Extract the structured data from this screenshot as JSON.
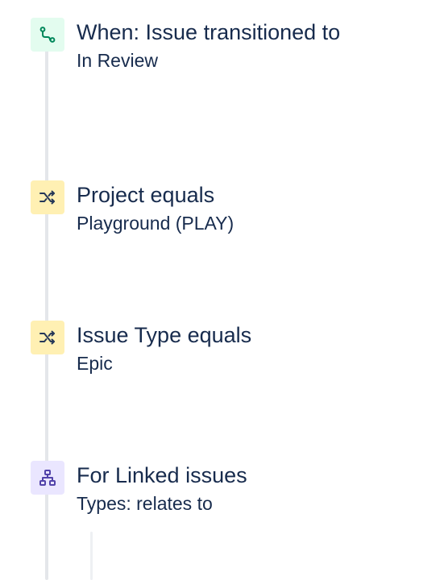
{
  "steps": [
    {
      "kind": "trigger",
      "icon": "trigger-path-icon",
      "title": "When: Issue transitioned to",
      "detail": "In Review"
    },
    {
      "kind": "condition",
      "icon": "shuffle-icon",
      "title": "Project equals",
      "detail": "Playground (PLAY)"
    },
    {
      "kind": "condition",
      "icon": "shuffle-icon",
      "title": "Issue Type equals",
      "detail": "Epic"
    },
    {
      "kind": "branch",
      "icon": "hierarchy-icon",
      "title": "For Linked issues",
      "detail": "Types: relates to"
    }
  ],
  "colors": {
    "trigger_bg": "#e3fcef",
    "trigger_fg": "#00875a",
    "condition_bg": "#fff0b3",
    "condition_fg": "#253858",
    "branch_bg": "#eae6ff",
    "branch_fg": "#5243aa",
    "text": "#172b4d",
    "rail": "#e4e6ea"
  }
}
